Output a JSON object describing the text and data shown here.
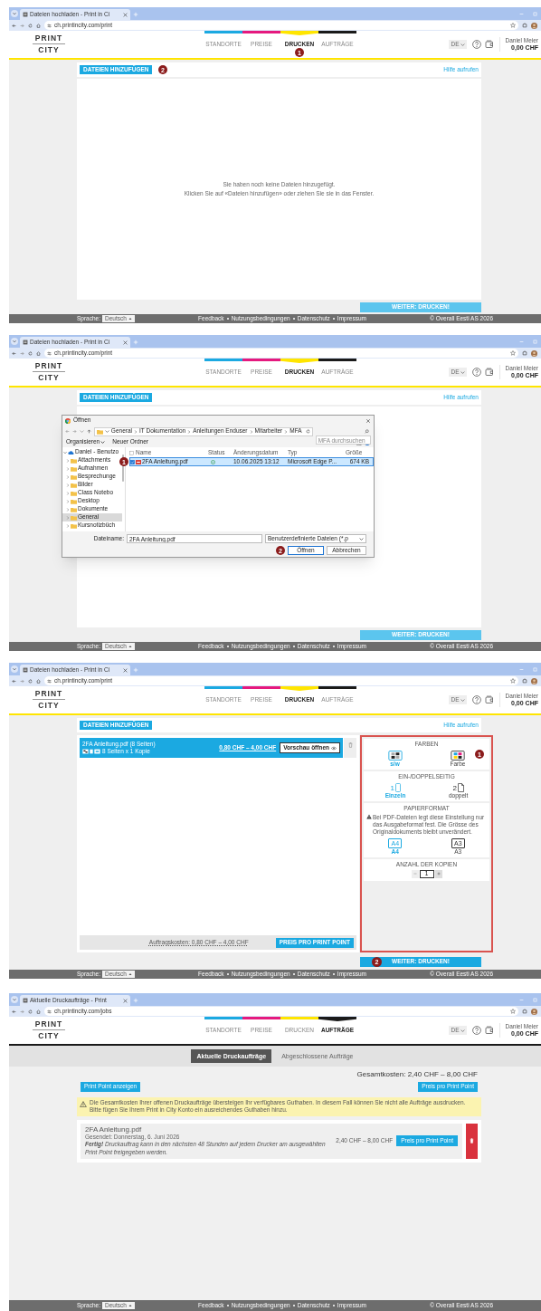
{
  "panels": [
    {
      "kind": "upload",
      "browser": {
        "tab_title": "Dateien hochladen - Print in Ci",
        "url": "ch.printincity.com/print"
      },
      "logo": {
        "top": "PRINT",
        "bottom": "CITY"
      },
      "nav": [
        {
          "label": "STANDORTE",
          "selected": false
        },
        {
          "label": "PREISE",
          "selected": false
        },
        {
          "label": "DRUCKEN",
          "selected": true,
          "marker": "1"
        },
        {
          "label": "AUFTRÄGE",
          "selected": false
        }
      ],
      "language": "DE",
      "user": {
        "name": "Daniel Meier",
        "balance": "0,00 CHF"
      },
      "add_button": {
        "label": "DATEIEN HINZUFÜGEN",
        "marker": "2"
      },
      "help_link": "Hilfe aufrufen",
      "empty_message": [
        "Sie haben noch keine Dateien hinzugefügt.",
        "Klicken Sie auf «Dateien hinzufügen» oder ziehen Sie sie in das Fenster."
      ],
      "continue_button": {
        "label": "WEITER: DRUCKEN!",
        "disabled": true
      },
      "footer": {
        "language_label": "Sprache:",
        "language": "Deutsch",
        "links": [
          "Feedback",
          "Nutzungsbedingungen",
          "Datenschutz",
          "Impressum"
        ],
        "copyright": "© Overall Eesti AS 2026"
      }
    },
    {
      "kind": "upload",
      "browser": {
        "tab_title": "Dateien hochladen - Print in Ci",
        "url": "ch.printincity.com/print"
      },
      "logo": {
        "top": "PRINT",
        "bottom": "CITY"
      },
      "nav": [
        {
          "label": "STANDORTE",
          "selected": false
        },
        {
          "label": "PREISE",
          "selected": false
        },
        {
          "label": "DRUCKEN",
          "selected": true
        },
        {
          "label": "AUFTRÄGE",
          "selected": false
        }
      ],
      "language": "DE",
      "user": {
        "name": "Daniel Meier",
        "balance": "0,00 CHF"
      },
      "add_button": {
        "label": "DATEIEN HINZUFÜGEN"
      },
      "help_link": "Hilfe aufrufen",
      "dialog": {
        "title": "Öffnen",
        "path": [
          "General",
          "IT Dokumentation",
          "Anleitungen Enduser",
          "Mitarbeiter",
          "MFA"
        ],
        "search_placeholder": "MFA durchsuchen",
        "organize": "Organisieren",
        "new_folder": "Neuer Ordner",
        "tree": [
          {
            "label": "Daniel - Benutzo",
            "expanded": true,
            "selected": false,
            "children": [
              {
                "label": "Attachments",
                "expanded": false,
                "selected": false
              },
              {
                "label": "Aufnahmen",
                "expanded": false,
                "selected": false
              },
              {
                "label": "Besprechunge",
                "expanded": false,
                "selected": false
              },
              {
                "label": "Bilder",
                "expanded": false,
                "selected": false
              },
              {
                "label": "Class Notebo",
                "expanded": false,
                "selected": false
              },
              {
                "label": "Desktop",
                "expanded": false,
                "selected": false
              },
              {
                "label": "Dokumente",
                "expanded": false,
                "selected": false
              },
              {
                "label": "General",
                "expanded": false,
                "selected": true
              },
              {
                "label": "Kursnotizbüch",
                "expanded": false,
                "selected": false
              }
            ]
          }
        ],
        "columns": [
          "Name",
          "Status",
          "Änderungsdatum",
          "Typ",
          "Größe"
        ],
        "files": [
          {
            "name": "2FA Anleitung.pdf",
            "date": "10.06.2025 13:12",
            "type": "Microsoft Edge P...",
            "size": "674 KB",
            "selected": true,
            "marker": "1"
          }
        ],
        "file_name_label": "Dateiname:",
        "file_name": "2FA Anleitung.pdf",
        "file_type": "Benutzerdefinierte Dateien (*.p",
        "open_button": {
          "label": "Öffnen",
          "marker": "2"
        },
        "cancel_button": "Abbrechen"
      },
      "continue_button": {
        "label": "WEITER: DRUCKEN!",
        "disabled": true
      },
      "footer": {
        "language_label": "Sprache:",
        "language": "Deutsch",
        "links": [
          "Feedback",
          "Nutzungsbedingungen",
          "Datenschutz",
          "Impressum"
        ],
        "copyright": "© Overall Eesti AS 2026"
      }
    },
    {
      "kind": "upload",
      "browser": {
        "tab_title": "Dateien hochladen - Print in Ci",
        "url": "ch.printincity.com/print"
      },
      "logo": {
        "top": "PRINT",
        "bottom": "CITY"
      },
      "nav": [
        {
          "label": "STANDORTE",
          "selected": false
        },
        {
          "label": "PREISE",
          "selected": false
        },
        {
          "label": "DRUCKEN",
          "selected": true
        },
        {
          "label": "AUFTRÄGE",
          "selected": false
        }
      ],
      "language": "DE",
      "user": {
        "name": "Daniel Meier",
        "balance": "0,00 CHF"
      },
      "add_button": {
        "label": "DATEIEN HINZUFÜGEN"
      },
      "help_link": "Hilfe aufrufen",
      "file": {
        "name": "2FA Anleitung.pdf (8 Seiten)",
        "summary": "8 Seiten x 1 Kopie",
        "price": "0,80 CHF – 4,00 CHF",
        "preview_button": "Vorschau öffnen",
        "cost": "Auftragskosten: 0,80 CHF – 4,00 CHF",
        "price_button": "PREIS PRO PRINT POINT"
      },
      "options": [
        {
          "kind": "colors",
          "title": "FARBEN",
          "choices": [
            {
              "label": "s/w",
              "selected": true
            },
            {
              "label": "Farbe",
              "selected": false,
              "marker": "1"
            }
          ]
        },
        {
          "kind": "sides",
          "title": "EIN-/DOPPELSEITIG",
          "choices": [
            {
              "badge": "1",
              "label": "Einzeln",
              "selected": true
            },
            {
              "badge": "2",
              "label": "doppelt",
              "selected": false
            }
          ]
        },
        {
          "kind": "paper",
          "title": "PAPIERFORMAT",
          "note": "Bei PDF-Dateien legt diese Einstellung nur das Ausgabeformat fest. Die Grösse des Originaldokuments bleibt unverändert.",
          "choices": [
            {
              "badge": "A4",
              "label": "A4",
              "selected": true
            },
            {
              "badge": "A3",
              "label": "A3",
              "selected": false
            }
          ]
        },
        {
          "kind": "copies",
          "title": "ANZAHL DER KOPIEN",
          "value": "1"
        }
      ],
      "continue_button": {
        "label": "WEITER: DRUCKEN!",
        "disabled": false,
        "marker": "2"
      },
      "footer": {
        "language_label": "Sprache:",
        "language": "Deutsch",
        "links": [
          "Feedback",
          "Nutzungsbedingungen",
          "Datenschutz",
          "Impressum"
        ],
        "copyright": "© Overall Eesti AS 2026"
      }
    },
    {
      "kind": "jobs",
      "browser": {
        "tab_title": "Aktuelle Druckaufträge - Print",
        "url": "ch.printincity.com/jobs"
      },
      "logo": {
        "top": "PRINT",
        "bottom": "CITY"
      },
      "nav": [
        {
          "label": "STANDORTE",
          "selected": false
        },
        {
          "label": "PREISE",
          "selected": false
        },
        {
          "label": "DRUCKEN",
          "selected": false
        },
        {
          "label": "AUFTRÄGE",
          "selected": true
        }
      ],
      "language": "DE",
      "user": {
        "name": "Daniel Meier",
        "balance": "0,00 CHF"
      },
      "tabs": [
        {
          "label": "Aktuelle Druckaufträge",
          "selected": true
        },
        {
          "label": "Abgeschlossene Aufträge",
          "selected": false
        }
      ],
      "total": "Gesamtkosten: 2,40 CHF – 8,00 CHF",
      "buttons": [
        "Print Point anzeigen",
        "Preis pro Print Point"
      ],
      "warning": "Die Gesamtkosten Ihrer offenen Druckaufträge übersteigen Ihr verfügbares Guthaben. In diesem Fall können Sie nicht alle Aufträge ausdrucken. Bitte fügen Sie Ihrem Print in City Konto ein ausreichendes Guthaben hinzu.",
      "jobs": [
        {
          "name": "2FA Anleitung.pdf",
          "sent": "Gesendet: Donnerstag, 6. Juni 2026",
          "status": "**Fertig!** Druckauftrag kann in den nächsten 48 Stunden auf jedem Drucker am ausgewählten Print Point freigegeben werden.",
          "price": "2,40 CHF – 8,00 CHF",
          "button": "Preis pro Print Point"
        }
      ],
      "footer": {
        "language_label": "Sprache:",
        "language": "Deutsch",
        "links": [
          "Feedback",
          "Nutzungsbedingungen",
          "Datenschutz",
          "Impressum"
        ],
        "copyright": "© Overall Eesti AS 2026"
      }
    }
  ]
}
